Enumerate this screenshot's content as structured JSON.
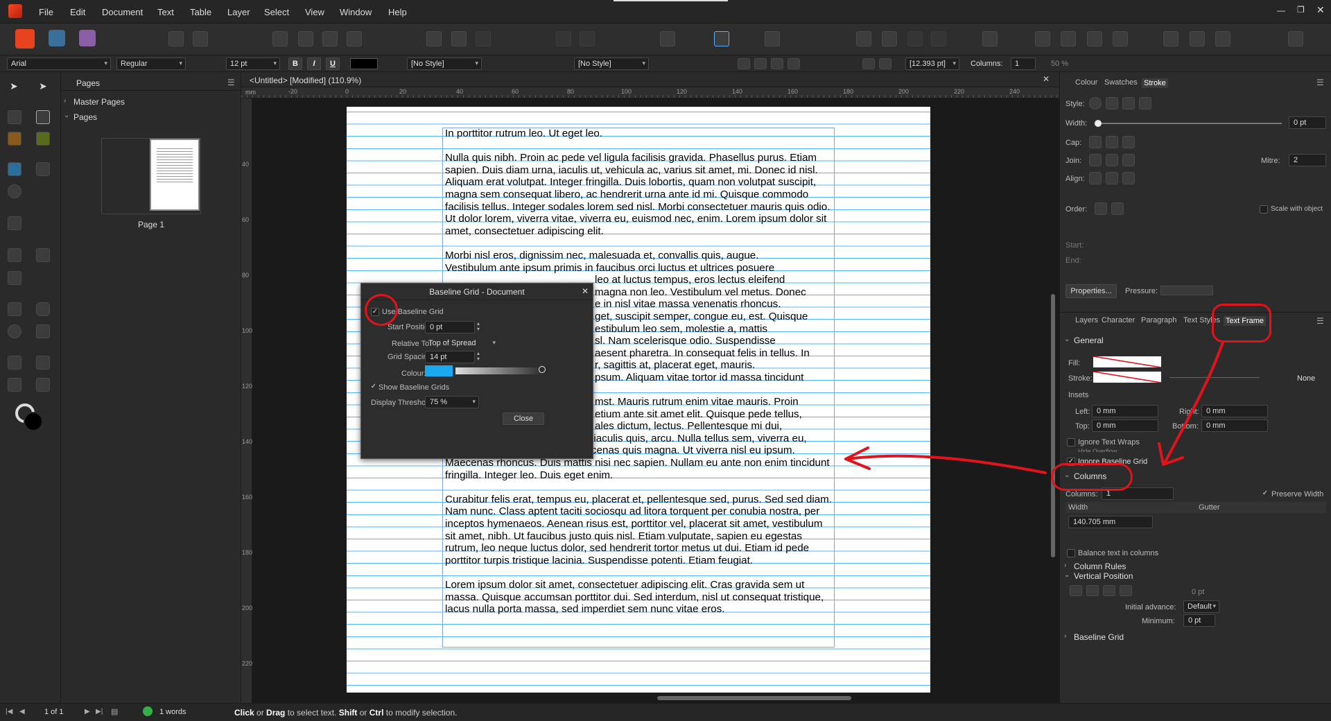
{
  "menu": {
    "items": [
      "File",
      "Edit",
      "Document",
      "Text",
      "Table",
      "Layer",
      "Select",
      "View",
      "Window",
      "Help"
    ]
  },
  "context": {
    "font": "Arial",
    "style": "Regular",
    "size": "12 pt",
    "char_style": "[No Style]",
    "para_style": "[No Style]",
    "leading": "[12.393 pt]",
    "columns_label": "Columns:",
    "columns_value": "1",
    "zoom_pct": "50 %"
  },
  "pages_panel": {
    "tab": "Pages",
    "master_pages": "Master Pages",
    "pages": "Pages",
    "page_label": "Page 1"
  },
  "document": {
    "tab_title": "<Untitled> [Modified] (110.9%)",
    "ruler_unit": "mm",
    "ruler_ticks_h": [
      "-20",
      "0",
      "20",
      "40",
      "60",
      "80",
      "100",
      "120",
      "140",
      "160",
      "180",
      "200",
      "220",
      "240"
    ],
    "ruler_ticks_v": [
      "40",
      "60",
      "80",
      "100",
      "120",
      "140",
      "160",
      "180",
      "200",
      "220"
    ]
  },
  "text": {
    "p1": "In porttitor rutrum leo. Ut eget leo.",
    "p2": "Nulla quis nibh. Proin ac pede vel ligula facilisis gravida. Phasellus purus. Etiam sapien. Duis diam urna, iaculis ut, vehicula ac, varius sit amet, mi. Donec id nisl. Aliquam erat volutpat. Integer fringilla. Duis lobortis, quam non volutpat suscipit, magna sem consequat libero, ac hendrerit urna ante id mi. Quisque commodo facilisis tellus. Integer sodales lorem sed nisl. Morbi consectetuer mauris quis odio. Ut dolor lorem, viverra vitae, viverra eu, euismod nec, enim. Lorem ipsum dolor sit amet, consectetuer adipiscing elit.",
    "p3a": "Morbi nisl eros, dignissim nec, malesuada et, convallis quis, augue.",
    "p3b": "Vestibulum ante ipsum primis in faucibus orci luctus et ultrices posuere",
    "p3c": "leo at luctus tempus, eros lectus eleifend",
    "p3d": "magna non leo. Vestibulum vel metus. Donec",
    "p3e": "e in nisl vitae massa venenatis rhoncus.",
    "p3f": "get, suscipit semper, congue eu, est. Quisque",
    "p3g": "estibulum leo sem, molestie a, mattis",
    "p3h": "sl. Nam scelerisque odio. Suspendisse",
    "p3i": "aesent pharetra. In consequat felis in tellus. In",
    "p3j": "r, sagittis at, placerat eget, mauris.",
    "p3k": "psum. Aliquam vitae tortor id massa tincidunt",
    "p4a": "mst. Mauris rutrum enim vitae mauris. Proin",
    "p4b": "etium ante sit amet elit. Quisque pede tellus,",
    "p4c": "ales dictum, lectus. Pellentesque mi dui,",
    "p4d": "molestie sit amet, adipiscing id, iaculis quis, arcu. Nulla tellus sem, viverra eu, ultricies ac, mattis et, velit. Maecenas quis magna. Ut viverra nisl eu ipsum. Maecenas rhoncus. Duis mattis nisi nec sapien. Nullam eu ante non enim tincidunt fringilla. Integer leo. Duis eget enim.",
    "p5": "Curabitur felis erat, tempus eu, placerat et, pellentesque sed, purus. Sed sed diam. Nam nunc. Class aptent taciti sociosqu ad litora torquent per conubia nostra, per inceptos hymenaeos. Aenean risus est, porttitor vel, placerat sit amet, vestibulum sit amet, nibh. Ut faucibus justo quis nisl. Etiam vulputate, sapien eu egestas rutrum, leo neque luctus dolor, sed hendrerit tortor metus ut dui. Etiam id pede porttitor turpis tristique lacinia. Suspendisse potenti. Etiam feugiat.",
    "p6": "Lorem ipsum dolor sit amet, consectetuer adipiscing elit. Cras gravida sem ut massa. Quisque accumsan porttitor dui. Sed interdum, nisl ut consequat tristique, lacus nulla porta massa, sed imperdiet sem nunc vitae eros."
  },
  "dialog": {
    "title": "Baseline Grid - Document",
    "use_baseline": "Use Baseline Grid",
    "start_label": "Start Position:",
    "start_value": "0 pt",
    "relative_label": "Relative To:",
    "relative_value": "Top of Spread",
    "spacing_label": "Grid Spacing:",
    "spacing_value": "14 pt",
    "colour_label": "Colour:",
    "colour_hex": "#1aa8f0",
    "show_grids": "Show Baseline Grids",
    "threshold_label": "Display Threshold:",
    "threshold_value": "75 %",
    "close": "Close"
  },
  "right_top": {
    "tabs": [
      "Colour",
      "Swatches",
      "Stroke"
    ],
    "style_label": "Style:",
    "width_label": "Width:",
    "width_value": "0 pt",
    "cap_label": "Cap:",
    "join_label": "Join:",
    "mitre_label": "Mitre:",
    "mitre_value": "2",
    "align_label": "Align:",
    "order_label": "Order:",
    "scale_label": "Scale with object",
    "start_label": "Start:",
    "end_label": "End:",
    "properties": "Properties...",
    "pressure_label": "Pressure:"
  },
  "right_bottom": {
    "tabs": [
      "Layers",
      "Character",
      "Paragraph",
      "Text Styles",
      "Text Frame"
    ],
    "general": "General",
    "fill_label": "Fill:",
    "stroke_label": "Stroke:",
    "none": "None",
    "insets": "Insets",
    "left_label": "Left:",
    "left_value": "0 mm",
    "right_label": "Right:",
    "right_value": "0 mm",
    "top_label": "Top:",
    "top_value": "0 mm",
    "bottom_label": "Bottom:",
    "bottom_value": "0 mm",
    "ignore_wraps": "Ignore Text Wraps",
    "hide_overflow": "Hide Overflow",
    "ignore_baseline": "Ignore Baseline Grid",
    "columns_sect": "Columns",
    "columns_label": "Columns:",
    "columns_value": "1",
    "preserve": "Preserve Width",
    "width_label": "Width",
    "gutter_label": "Gutter",
    "width_value": "140.705 mm",
    "balance": "Balance text in columns",
    "column_rules": "Column Rules",
    "vertical_position": "Vertical Position",
    "vp_value": "0 pt",
    "initial_label": "Initial advance:",
    "initial_value": "Default",
    "minimum_label": "Minimum:",
    "minimum_value": "0 pt",
    "baseline_grid": "Baseline Grid"
  },
  "status": {
    "page": "1 of 1",
    "words": "1 words",
    "hint_click": "Click",
    "hint_or": " or ",
    "hint_drag": "Drag",
    "hint_mid": " to select text. ",
    "hint_shift": "Shift",
    "hint_or2": " or ",
    "hint_ctrl": "Ctrl",
    "hint_end": " to modify selection."
  },
  "colors": {
    "accent": "#1aa8f0",
    "annotation": "#e0141a"
  }
}
